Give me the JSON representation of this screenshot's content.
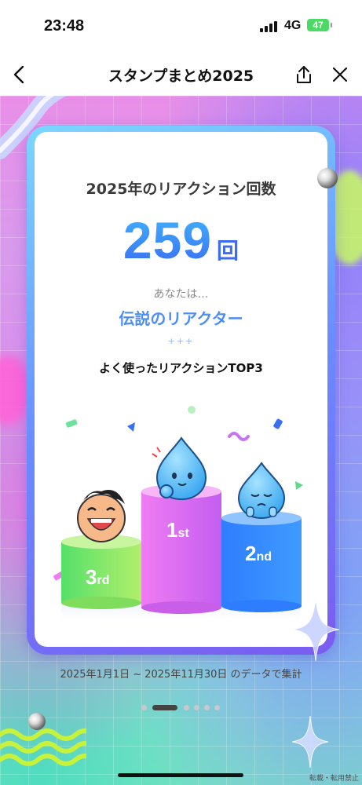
{
  "status_bar": {
    "time": "23:48",
    "network": "4G",
    "battery": "47"
  },
  "nav": {
    "title": "スタンプまとめ2025",
    "back_icon": "chevron-left-icon",
    "share_icon": "share-icon",
    "close_icon": "close-icon"
  },
  "card": {
    "heading": "2025年のリアクション回数",
    "count": "259",
    "count_unit": "回",
    "you_are": "あなたは…",
    "title_label": "伝説のリアクター",
    "sparks": "+++",
    "top3_label": "よく使ったリアクションTOP3",
    "podium": [
      {
        "rank": 1,
        "label_num": "1",
        "label_suffix": "st",
        "color": "#e87cf0"
      },
      {
        "rank": 2,
        "label_num": "2",
        "label_suffix": "nd",
        "color": "#3a86ff"
      },
      {
        "rank": 3,
        "label_num": "3",
        "label_suffix": "rd",
        "color": "#7ed957"
      }
    ]
  },
  "footer": {
    "range": "2025年1月1日 ~ 2025年11月30日 のデータで集計",
    "copy_note": "転載・転用禁止",
    "pages": 6,
    "active_page": 1
  },
  "colors": {
    "accent_blue": "#3b6cf2",
    "title_blue": "#4d8ef6",
    "battery_green": "#4cd964"
  }
}
